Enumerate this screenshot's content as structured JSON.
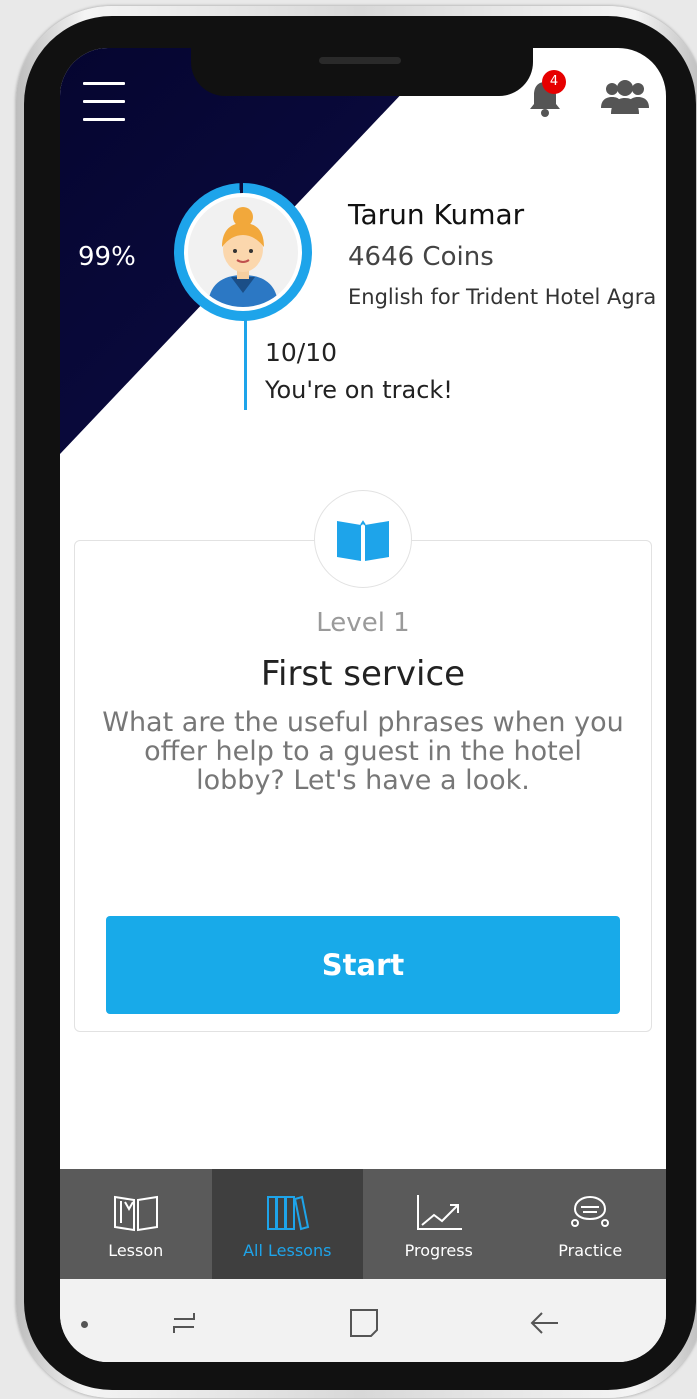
{
  "header": {
    "notification_count": "4"
  },
  "profile": {
    "percent": "99%",
    "name": "Tarun Kumar",
    "coins": "4646 Coins",
    "course": "English for Trident Hotel Agra",
    "score": "10/10",
    "track_status": "You're on track!"
  },
  "lesson_card": {
    "level": "Level 1",
    "title": "First service",
    "description": "What are the useful phrases when you offer help to a guest in the hotel lobby? Let's have a look.",
    "start_label": "Start"
  },
  "bottom_nav": {
    "items": [
      {
        "label": "Lesson",
        "icon": "open-book-icon",
        "active": false
      },
      {
        "label": "All Lessons",
        "icon": "books-icon",
        "active": true
      },
      {
        "label": "Progress",
        "icon": "chart-icon",
        "active": false
      },
      {
        "label": "Practice",
        "icon": "practice-icon",
        "active": false
      }
    ]
  },
  "colors": {
    "accent": "#1ea4ea",
    "header_dark": "#0a0a3c",
    "nav_bg": "#5a5a5a",
    "badge": "#e60000"
  }
}
